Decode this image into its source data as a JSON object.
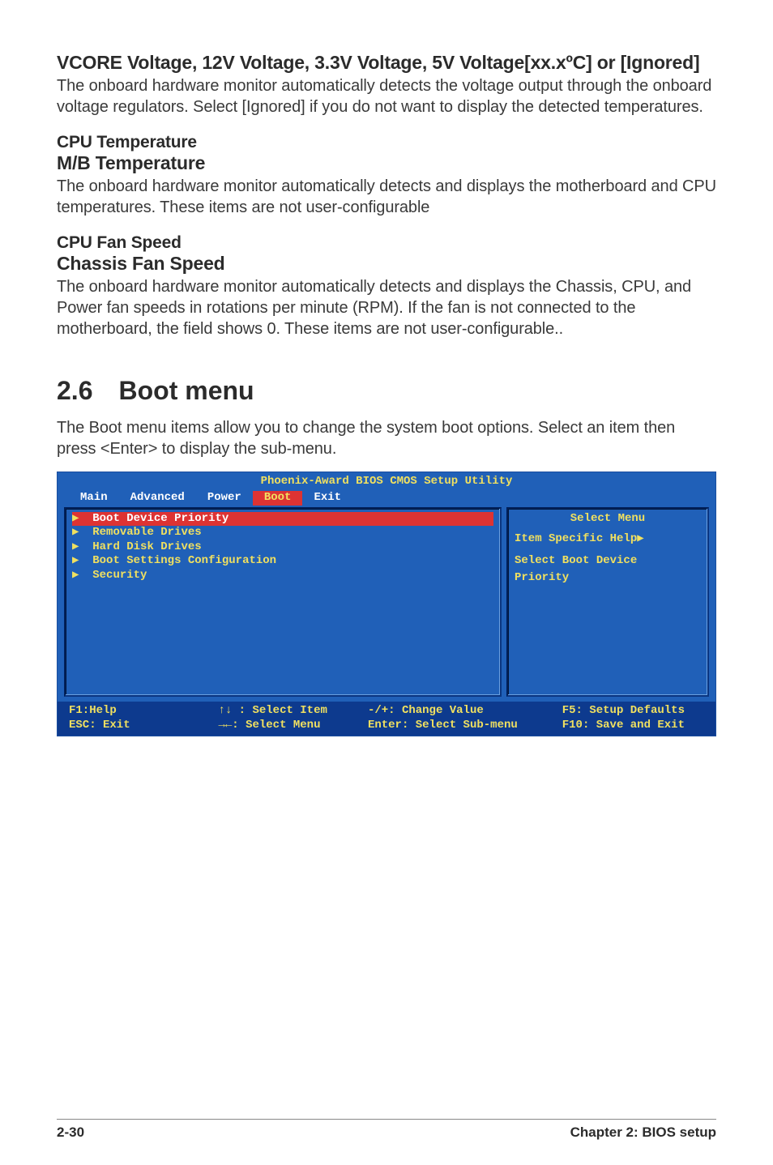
{
  "sections": {
    "s1": {
      "heading": "VCORE Voltage, 12V Voltage, 3.3V Voltage, 5V Voltage[xx.xºC] or [Ignored]",
      "body": "The onboard hardware monitor automatically detects the voltage output through the onboard voltage regulators. Select [Ignored] if you do not want to display the detected temperatures."
    },
    "s2": {
      "heading_a": "CPU Temperature",
      "heading_b": "M/B Temperature",
      "body": "The onboard hardware monitor automatically detects and displays the motherboard and CPU temperatures. These items are not user-configurable"
    },
    "s3": {
      "heading_a": "CPU Fan Speed",
      "heading_b": "Chassis Fan Speed",
      "body": "The onboard hardware monitor automatically detects and displays the Chassis, CPU, and Power fan speeds in rotations per minute (RPM). If the fan is not connected to the motherboard, the field shows 0. These items are not user-configurable.."
    }
  },
  "chapter": {
    "num": "2.6",
    "title": "Boot menu",
    "intro": "The Boot menu items allow you to change the system boot options. Select an item then press <Enter> to display the sub-menu."
  },
  "bios": {
    "title": "Phoenix-Award BIOS CMOS Setup Utility",
    "tabs": [
      "Main",
      "Advanced",
      "Power",
      "Boot",
      "Exit"
    ],
    "selected_tab": "Boot",
    "items": [
      "Boot Device Priority",
      "Removable Drives",
      "Hard Disk Drives",
      "Boot Settings Configuration",
      "Security"
    ],
    "highlighted_item": "Boot Device Priority",
    "right": {
      "title": "Select Menu",
      "help_line1": "Item Specific Help▶",
      "help_line2": "Select Boot Device",
      "help_line3": "Priority"
    },
    "footer": {
      "c1a": "F1:Help",
      "c1b": "ESC: Exit",
      "c2a": "↑↓ : Select Item",
      "c2b": "→←: Select Menu",
      "c3a": "-/+: Change Value",
      "c3b": "Enter: Select Sub-menu",
      "c4a": "F5: Setup Defaults",
      "c4b": "F10: Save and Exit"
    }
  },
  "footer": {
    "page": "2-30",
    "chapter": "Chapter 2: BIOS setup"
  }
}
